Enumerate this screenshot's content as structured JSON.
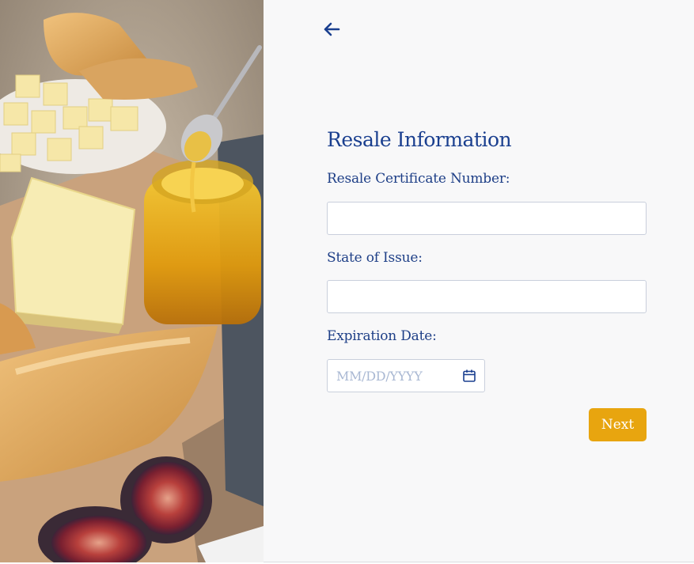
{
  "form": {
    "title": "Resale Information",
    "fields": [
      {
        "label": "Resale Certificate Number:",
        "value": ""
      },
      {
        "label": "State of Issue:",
        "value": ""
      },
      {
        "label": "Expiration Date:",
        "placeholder": "MM/DD/YYYY"
      }
    ],
    "next_label": "Next"
  },
  "icons": {
    "back": "arrow-left-icon",
    "calendar": "calendar-icon"
  },
  "colors": {
    "accent": "#1a3f8f",
    "button": "#e8a50f",
    "panel_bg": "#f8f8f9",
    "input_border": "#c9cfdc",
    "placeholder": "#a9b8d3"
  }
}
